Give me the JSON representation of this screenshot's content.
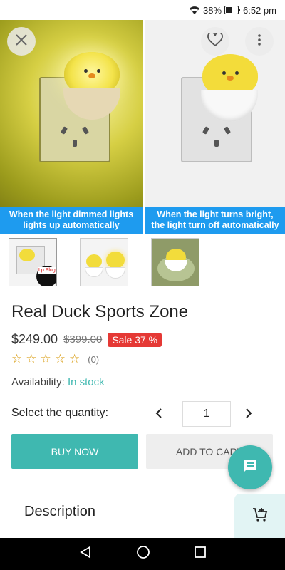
{
  "status_bar": {
    "battery": "38%",
    "time": "6:52 pm"
  },
  "hero": {
    "left_caption_line1": "When the light dimmed lights",
    "left_caption_line2": "lights up automatically",
    "right_caption_line1": "When the light turns bright,",
    "right_caption_line2": "the light turn off automatically"
  },
  "product": {
    "title": "Real Duck Sports Zone",
    "price": "$249.00",
    "old_price": "$399.00",
    "sale_badge": "Sale 37 %",
    "rating_count": "(0)",
    "rating_value": 0,
    "availability_label": "Availability:",
    "availability_value": "In stock",
    "quantity_label": "Select the quantity:",
    "quantity_value": "1"
  },
  "actions": {
    "buy_now": "BUY NOW",
    "add_to_cart": "ADD TO CART"
  },
  "sections": {
    "description": "Description"
  },
  "thumbnail_badge": "Lp Plug",
  "colors": {
    "accent": "#3fb8b0",
    "sale": "#e53935",
    "caption_bg": "#1e9bef",
    "star": "#d89a0b"
  },
  "icons": [
    "close-icon",
    "heart-icon",
    "more-vertical-icon",
    "chat-icon",
    "add-to-cart-icon",
    "back-nav-icon",
    "home-nav-icon",
    "recents-nav-icon",
    "wifi-icon",
    "battery-icon"
  ]
}
